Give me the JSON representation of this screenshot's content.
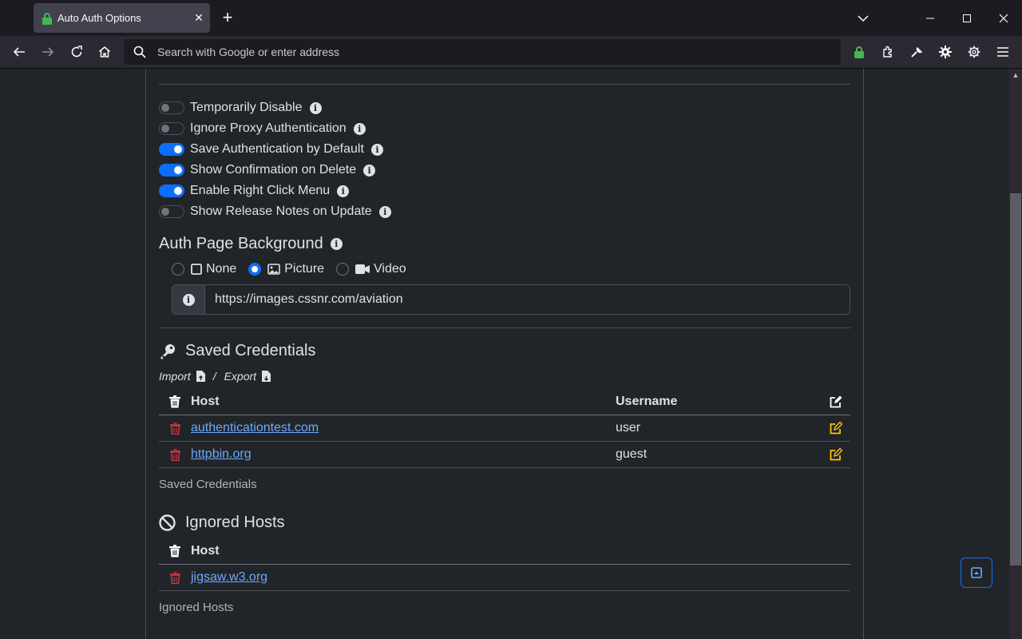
{
  "browser": {
    "tab_title": "Auto Auth Options",
    "url_placeholder": "Search with Google or enter address"
  },
  "options": [
    {
      "label": "Temporarily Disable",
      "enabled": false
    },
    {
      "label": "Ignore Proxy Authentication",
      "enabled": false
    },
    {
      "label": "Save Authentication by Default",
      "enabled": true
    },
    {
      "label": "Show Confirmation on Delete",
      "enabled": true
    },
    {
      "label": "Enable Right Click Menu",
      "enabled": true
    },
    {
      "label": "Show Release Notes on Update",
      "enabled": false
    }
  ],
  "background": {
    "heading": "Auth Page Background",
    "choices": [
      "None",
      "Picture",
      "Video"
    ],
    "selected": "Picture",
    "url_value": "https://images.cssnr.com/aviation"
  },
  "credentials": {
    "heading": "Saved Credentials",
    "import_label": "Import",
    "separator": "/",
    "export_label": "Export",
    "col_host": "Host",
    "col_username": "Username",
    "rows": [
      {
        "host": "authenticationtest.com",
        "username": "user"
      },
      {
        "host": "httpbin.org",
        "username": "guest"
      }
    ],
    "caption": "Saved Credentials"
  },
  "ignored": {
    "heading": "Ignored Hosts",
    "col_host": "Host",
    "rows": [
      {
        "host": "jigsaw.w3.org"
      }
    ],
    "caption": "Ignored Hosts"
  },
  "colors": {
    "accent": "#0d6efd",
    "danger": "#dc3545",
    "warning": "#ffc107",
    "link": "#6ea8fe"
  }
}
